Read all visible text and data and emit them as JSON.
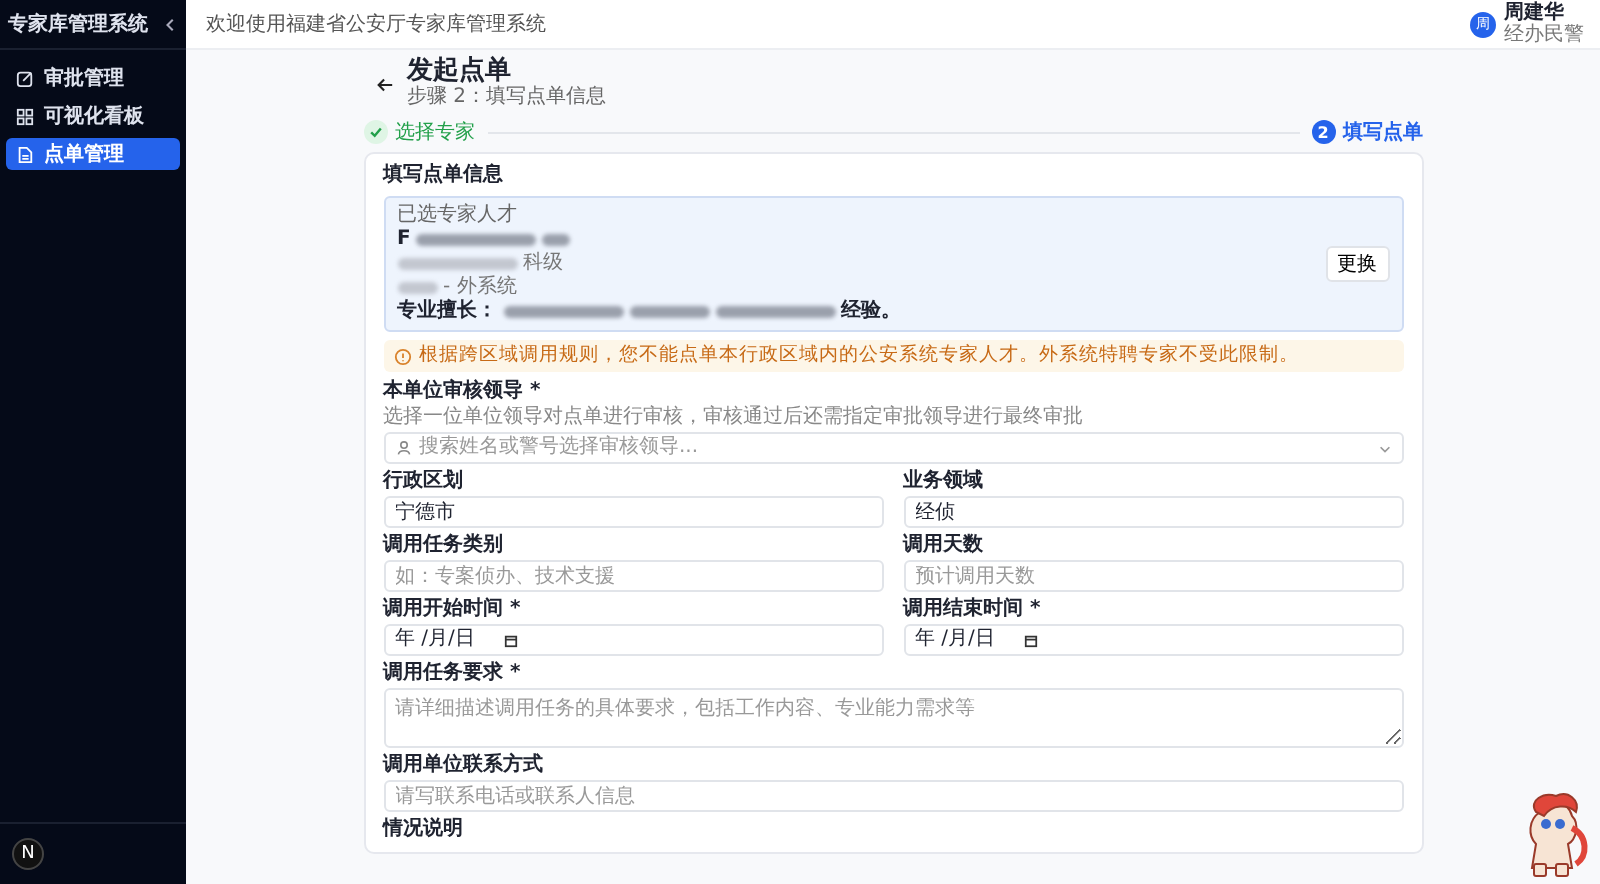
{
  "sidebar": {
    "title": "专家库管理系统",
    "items": [
      {
        "label": "审批管理",
        "selected": false
      },
      {
        "label": "可视化看板",
        "selected": false
      },
      {
        "label": "点单管理",
        "selected": true
      }
    ],
    "badge_letter": "N"
  },
  "header": {
    "welcome": "欢迎使用福建省公安厅专家库管理系统",
    "user": {
      "avatar": "周",
      "name": "周建华",
      "role": "经办民警"
    }
  },
  "page": {
    "title": "发起点单",
    "subtitle": "步骤 2：填写点单信息"
  },
  "steps": [
    {
      "label": "选择专家",
      "done": true
    },
    {
      "number": "2",
      "label": "填写点单",
      "done": false
    }
  ],
  "card": {
    "title": "填写点单信息",
    "expert": {
      "heading": "已选专家人才",
      "name_visible": "F",
      "line_2_visible": "科级",
      "line_3_visible": "- 外系统",
      "skill_label": "专业擅长：",
      "skill_visible": "经验。",
      "change_button": "更换"
    },
    "warning": "根据跨区域调用规则，您不能点单本行政区域内的公安系统专家人才。外系统特聘专家不受此限制。",
    "fields": [
      {
        "kind": "select",
        "label": "本单位审核领导 *",
        "hint": "选择一位单位领导对点单进行审核，审核通过后还需指定审批领导进行最终审批",
        "placeholder": "搜索姓名或警号选择审核领导...",
        "full": true
      },
      {
        "kind": "text",
        "label": "行政区划",
        "value": "宁德市",
        "full": false
      },
      {
        "kind": "text",
        "label": "业务领域",
        "value": "经侦",
        "full": false
      },
      {
        "kind": "text",
        "label": "调用任务类别",
        "placeholder": "如：专案侦办、技术支援",
        "full": false
      },
      {
        "kind": "text",
        "label": "调用天数",
        "placeholder": "预计调用天数",
        "full": false
      },
      {
        "kind": "date",
        "label": "调用开始时间 *",
        "placeholder": "年 /月/日",
        "full": false
      },
      {
        "kind": "date",
        "label": "调用结束时间 *",
        "placeholder": "年 /月/日",
        "full": false
      },
      {
        "kind": "textarea",
        "label": "调用任务要求 *",
        "placeholder": "请详细描述调用任务的具体要求，包括工作内容、专业能力需求等",
        "full": true
      },
      {
        "kind": "text",
        "label": "调用单位联系方式",
        "placeholder": "请写联系电话或联系人信息",
        "full": true
      },
      {
        "kind": "heading",
        "label": "情况说明",
        "full": true
      }
    ]
  }
}
